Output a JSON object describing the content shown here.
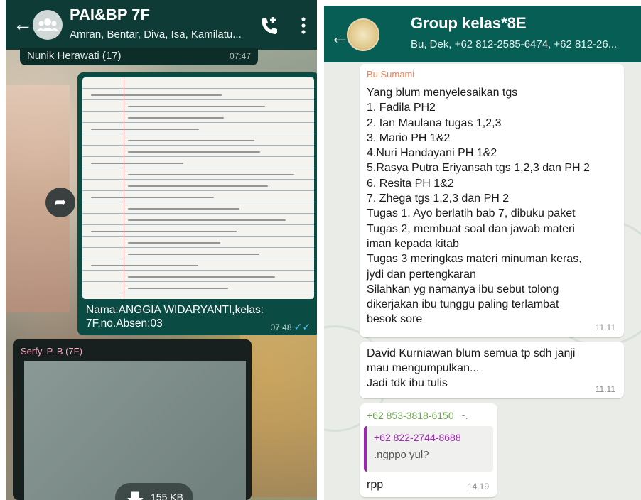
{
  "left_chat": {
    "header": {
      "title": "PAI&BP 7F",
      "subtitle": "Amran, Bentar, Diva, Isa, Kamilatu...",
      "back_icon": "arrow-left-icon",
      "add_call_icon": "add-call-icon",
      "menu_icon": "more-vertical-icon"
    },
    "top_strip": {
      "name": "Nunik Herawati (17)",
      "time": "07:47"
    },
    "image_message": {
      "caption": "Nama:ANGGIA WIDARYANTI,kelas: 7F,no.Absen:03",
      "time": "07:48",
      "status_icon": "double-check-icon"
    },
    "file_message": {
      "sender": "Serfy. P. B (7F)",
      "size": "155 KB",
      "download_icon": "download-icon"
    },
    "forward_icon": "forward-icon"
  },
  "right_chat": {
    "header": {
      "title": "Group kelas*8E",
      "subtitle": "Bu, Dek, +62 812-2585-6474, +62 812-26...",
      "back_icon": "arrow-left-icon"
    },
    "messages": [
      {
        "sender": "Bu Sumami",
        "text": "Yang blum menyelesaikan tgs\n1. Fadila PH2\n2. Ian Maulana tugas 1,2,3\n3. Mario PH 1&2\n4.Nuri Handayani PH 1&2\n5.Rasya Putra Eriyansah tgs 1,2,3 dan PH 2\n6. Resita PH 1&2\n7. Zhega tgs 1,2,3 dan PH 2\nTugas 1. Ayo berlatih bab 7, dibuku paket\nTugas 2, membuat soal dan jawab materi\niman kepada kitab\nTugas 3 meringkas materi minuman keras,\njydi dan pertengkaran\nSilahkan yg namanya ibu sebut tolong\ndikerjakan ibu tunggu paling terlambat\nbesok sore",
        "time": "11.11"
      },
      {
        "text": "David Kurniawan blum semua tp sdh janji\nmau mengumpulkan...\nJadi tdk ibu tulis",
        "time": "11.11"
      },
      {
        "sender": "+62 853-3818-6150",
        "sender_suffix": "~.",
        "quote_sender": "+62 822-2744-8688",
        "quote_text": ".ngppo yul?",
        "text": "rpp",
        "time": "14.19"
      }
    ]
  },
  "colors": {
    "left_header": "#0e3b35",
    "right_header": "#075e54",
    "outgoing_bubble": "#0a4c43",
    "read_ticks": "#53bdeb",
    "sender_orange": "#e8845a",
    "sender_green": "#6aa84f",
    "quote_purple": "#9c27b0"
  }
}
